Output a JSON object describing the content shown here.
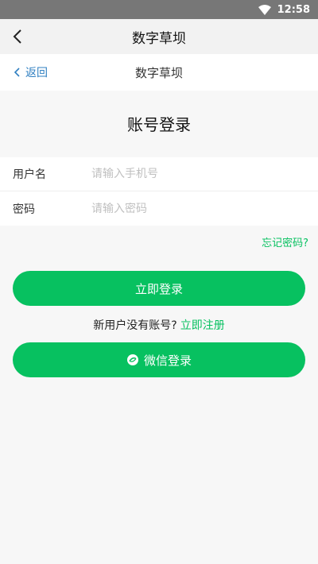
{
  "status_bar": {
    "time": "12:58"
  },
  "app_bar": {
    "title": "数字草坝"
  },
  "nav": {
    "back_label": "返回",
    "title": "数字草坝"
  },
  "page": {
    "heading": "账号登录"
  },
  "form": {
    "username_label": "用户名",
    "username_placeholder": "请输入手机号",
    "password_label": "密码",
    "password_placeholder": "请输入密码"
  },
  "links": {
    "forgot_password": "忘记密码?"
  },
  "buttons": {
    "login": "立即登录",
    "wechat_login": "微信登录"
  },
  "register": {
    "prompt": "新用户没有账号?",
    "link": "立即注册"
  },
  "colors": {
    "accent": "#07c160",
    "link_blue": "#2f7fc1",
    "status_bar": "#777777"
  }
}
